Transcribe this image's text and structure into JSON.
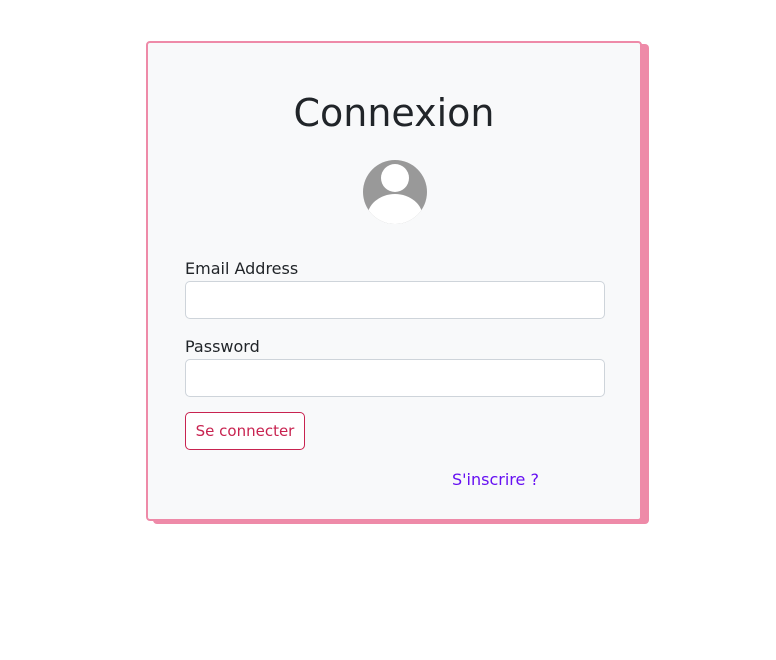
{
  "login": {
    "title": "Connexion",
    "email_label": "Email Address",
    "email_value": "",
    "password_label": "Password",
    "password_value": "",
    "submit_label": "Se connecter",
    "register_link": "S'inscrire ?"
  },
  "icons": {
    "avatar": "user-avatar-icon"
  },
  "colors": {
    "card_border": "#ee8aa8",
    "card_background": "#f8f9fa",
    "button_accent": "#c82350",
    "link": "#6610f2",
    "avatar": "#999999"
  }
}
